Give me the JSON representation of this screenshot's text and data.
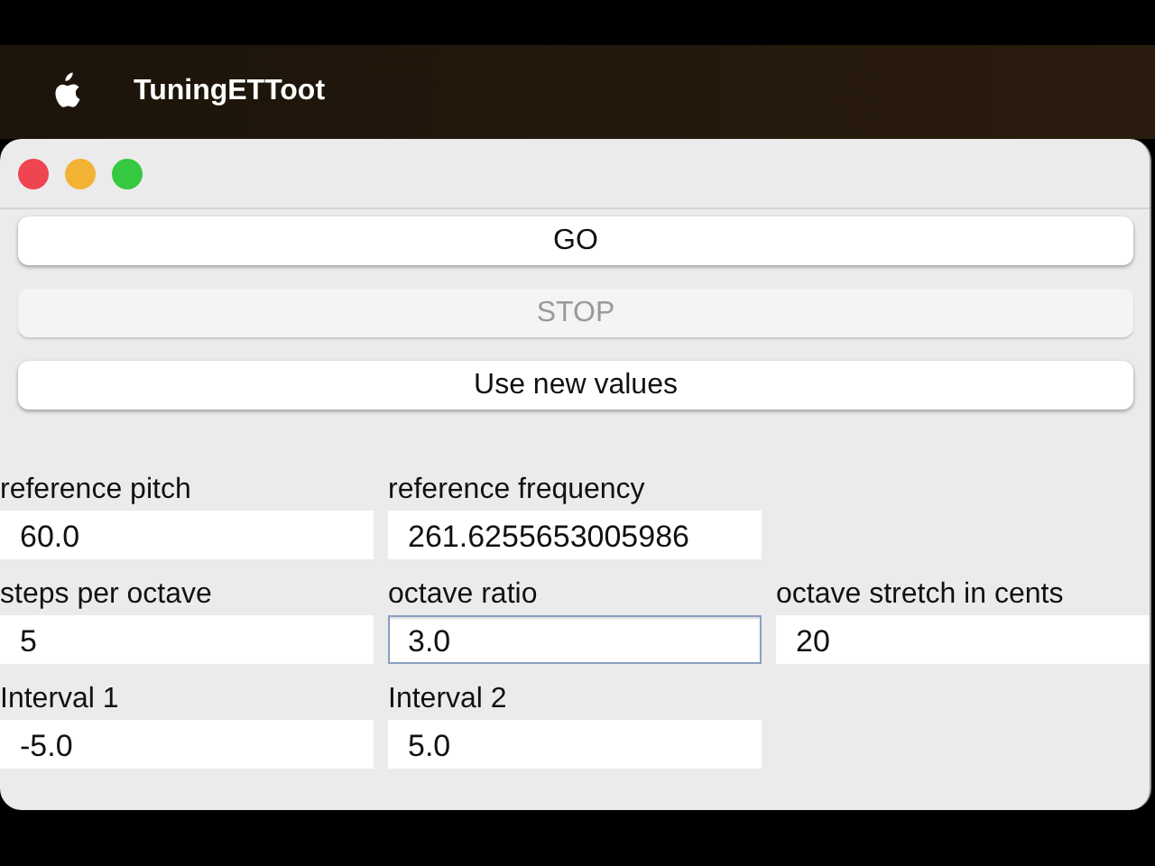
{
  "menu_bar": {
    "app_name": "TuningETToot"
  },
  "buttons": [
    {
      "label": "GO",
      "disabled": false
    },
    {
      "label": "STOP",
      "disabled": true
    },
    {
      "label": "Use new values",
      "disabled": false
    }
  ],
  "field_rows": [
    [
      {
        "label": "reference pitch",
        "value": "60.0",
        "focused": false
      },
      {
        "label": "reference frequency",
        "value": "261.6255653005986",
        "focused": false
      }
    ],
    [
      {
        "label": "steps per octave",
        "value": "5",
        "focused": false
      },
      {
        "label": "octave ratio",
        "value": "3.0",
        "focused": true
      },
      {
        "label": "octave stretch in cents",
        "value": "20",
        "focused": false
      }
    ],
    [
      {
        "label": "Interval 1",
        "value": "-5.0",
        "focused": false
      },
      {
        "label": "Interval 2",
        "value": "5.0",
        "focused": false
      }
    ]
  ]
}
